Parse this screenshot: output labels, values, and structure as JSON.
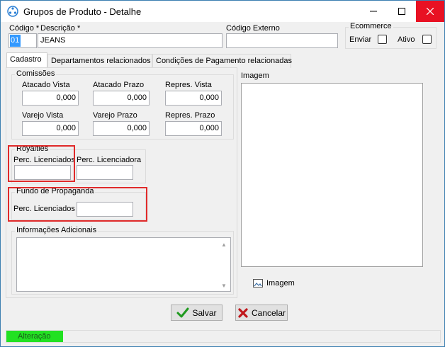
{
  "window": {
    "title": "Grupos de Produto - Detalhe",
    "minimize_icon": "minimize-icon",
    "maximize_icon": "maximize-icon",
    "close_icon": "close-icon"
  },
  "header": {
    "codigo_label": "Código *",
    "codigo_value": "01",
    "descricao_label": "Descrição *",
    "descricao_value": "JEANS",
    "codigo_externo_label": "Código Externo",
    "codigo_externo_value": "",
    "ecommerce": {
      "title": "Ecommerce",
      "enviar_label": "Enviar",
      "ativo_label": "Ativo"
    }
  },
  "tabs": [
    {
      "label": "Cadastro",
      "active": true
    },
    {
      "label": "Departamentos relacionados",
      "active": false
    },
    {
      "label": "Condições de Pagamento relacionadas",
      "active": false
    }
  ],
  "comissoes": {
    "title": "Comissões",
    "fields": [
      {
        "label": "Atacado Vista",
        "value": "0,000"
      },
      {
        "label": "Atacado Prazo",
        "value": "0,000"
      },
      {
        "label": "Repres. Vista",
        "value": "0,000"
      },
      {
        "label": "Varejo Vista",
        "value": "0,000"
      },
      {
        "label": "Varejo Prazo",
        "value": "0,000"
      },
      {
        "label": "Repres. Prazo",
        "value": "0,000"
      }
    ]
  },
  "royalties": {
    "title": "Royalties",
    "perc_licenciados_label": "Perc. Licenciados",
    "perc_licenciados_value": "",
    "perc_licenciadora_label": "Perc. Licenciadora",
    "perc_licenciadora_value": ""
  },
  "fundo": {
    "title": "Fundo de Propaganda",
    "perc_licenciados_label": "Perc. Licenciados",
    "perc_licenciados_value": ""
  },
  "info": {
    "title": "Informações Adicionais",
    "value": ""
  },
  "imagem": {
    "title": "Imagem",
    "button_label": "Imagem"
  },
  "buttons": {
    "salvar": "Salvar",
    "cancelar": "Cancelar"
  },
  "status": {
    "text": "Alteração",
    "color": "#22e122"
  },
  "colors": {
    "highlight_red": "#e02a2a",
    "selection_blue": "#3399ff"
  }
}
